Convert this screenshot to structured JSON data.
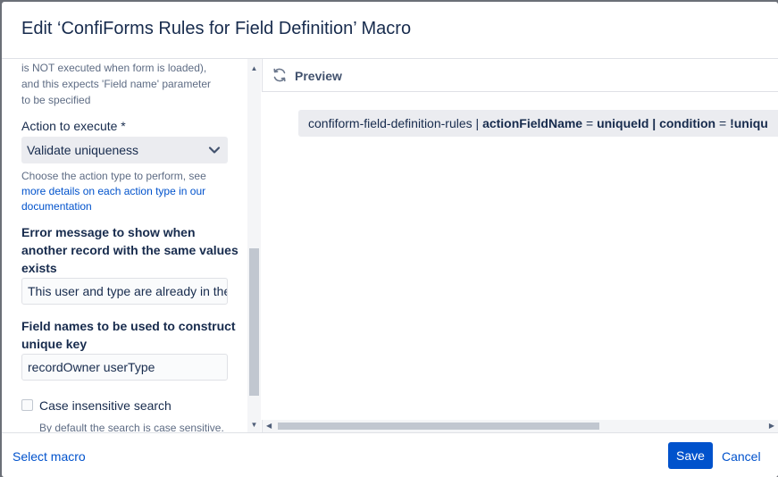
{
  "dialog": {
    "title": "Edit ‘ConfiForms Rules for Field Definition’ Macro"
  },
  "form": {
    "prev_help_line1": "is NOT executed when form is loaded),",
    "prev_help_line2": "and this expects 'Field name' parameter",
    "prev_help_line3": "to be specified",
    "action_label": "Action to execute *",
    "action_value": "Validate uniqueness",
    "action_help_line1": "Choose the action type to perform, see",
    "action_help_link_line1": "more details on each action type in our",
    "action_help_link_line2": "documentation",
    "error_label_line1": "Error message to show when",
    "error_label_line2": "another record with the same values",
    "error_label_line3": "exists",
    "error_value": "This user and type are already in the",
    "fieldnames_label_line1": "Field names to be used to construct",
    "fieldnames_label_line2": "unique key",
    "fieldnames_value": "recordOwner userType",
    "case_label": "Case insensitive search",
    "case_help": "By default the search is case sensitive."
  },
  "preview": {
    "title": "Preview",
    "macro_name": "confiform-field-definition-rules",
    "sep": "|",
    "param1_key": "actionFieldName",
    "eq": "=",
    "param1_value": "uniqueId",
    "param2_key": "condition",
    "param2_value": "!uniqu"
  },
  "footer": {
    "select_macro": "Select macro",
    "save": "Save",
    "cancel": "Cancel"
  },
  "icons": {
    "refresh": "refresh-icon",
    "chevron": "chevron-down-icon"
  }
}
